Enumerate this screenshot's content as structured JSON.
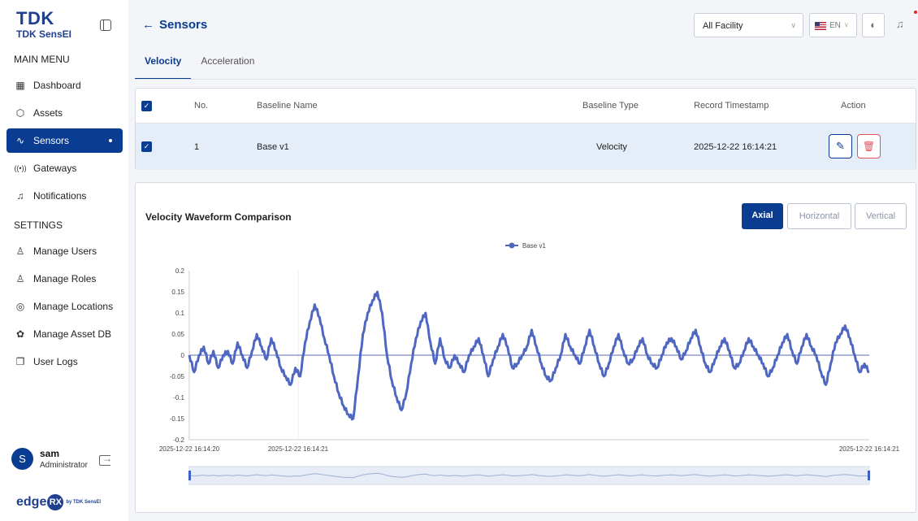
{
  "brand": {
    "logo_text": "TDK",
    "product": "TDK SensEI",
    "footer_logo": "edge",
    "footer_rx": "RX",
    "footer_by": "by TDK SensEI"
  },
  "sidebar": {
    "main_menu_title": "MAIN MENU",
    "settings_title": "SETTINGS",
    "main_items": [
      {
        "label": "Dashboard",
        "icon": "dashboard-icon"
      },
      {
        "label": "Assets",
        "icon": "cube-icon"
      },
      {
        "label": "Sensors",
        "icon": "pulse-icon",
        "active": true
      },
      {
        "label": "Gateways",
        "icon": "broadcast-icon"
      },
      {
        "label": "Notifications",
        "icon": "bell-icon"
      }
    ],
    "settings_items": [
      {
        "label": "Manage Users",
        "icon": "user-icon"
      },
      {
        "label": "Manage Roles",
        "icon": "role-icon"
      },
      {
        "label": "Manage Locations",
        "icon": "location-icon"
      },
      {
        "label": "Manage Asset DB",
        "icon": "database-icon"
      },
      {
        "label": "User Logs",
        "icon": "logs-icon"
      }
    ]
  },
  "user": {
    "initial": "S",
    "name": "sam",
    "role": "Administrator"
  },
  "header": {
    "title": "Sensors",
    "facility_select": "All Facility",
    "language": "EN",
    "tabs": [
      {
        "label": "Velocity",
        "active": true
      },
      {
        "label": "Acceleration",
        "active": false
      }
    ]
  },
  "table": {
    "columns": [
      "No.",
      "Baseline Name",
      "Baseline Type",
      "Record Timestamp",
      "Action"
    ],
    "rows": [
      {
        "no": "1",
        "name": "Base v1",
        "type": "Velocity",
        "timestamp": "2025-12-22 16:14:21",
        "selected": true
      }
    ]
  },
  "chart_card": {
    "title": "Velocity Waveform Comparison",
    "axis_buttons": [
      {
        "label": "Axial",
        "active": true
      },
      {
        "label": "Horizontal",
        "active": false
      },
      {
        "label": "Vertical",
        "active": false
      }
    ]
  },
  "chart_data": {
    "type": "line",
    "title": "Velocity Waveform Comparison",
    "legend_position": "top-center",
    "ylim": [
      -0.2,
      0.2
    ],
    "y_ticks": [
      "0.2",
      "0.15",
      "0.1",
      "0.05",
      "0",
      "-0.05",
      "-0.1",
      "-0.15",
      "-0.2"
    ],
    "x_tick_labels": [
      "2025-12-22 16:14:20",
      "2025-12-22 16:14:21",
      "2025-12-22 16:14:21"
    ],
    "series": [
      {
        "name": "Base v1",
        "color": "#4f67c1",
        "values": [
          0.0,
          -0.04,
          0.0,
          0.02,
          -0.02,
          0.01,
          -0.03,
          0.0,
          0.01,
          -0.02,
          0.03,
          0.0,
          -0.03,
          0.01,
          0.05,
          0.02,
          -0.01,
          0.04,
          0.01,
          -0.03,
          -0.05,
          -0.07,
          -0.03,
          -0.05,
          0.03,
          0.08,
          0.12,
          0.09,
          0.04,
          0.0,
          -0.05,
          -0.09,
          -0.12,
          -0.14,
          -0.15,
          -0.05,
          0.05,
          0.1,
          0.13,
          0.15,
          0.1,
          0.0,
          -0.06,
          -0.1,
          -0.13,
          -0.09,
          -0.02,
          0.04,
          0.08,
          0.1,
          0.03,
          -0.02,
          0.04,
          -0.01,
          -0.03,
          0.0,
          -0.02,
          -0.04,
          0.0,
          0.02,
          0.04,
          0.0,
          -0.05,
          -0.01,
          0.02,
          0.05,
          0.02,
          -0.03,
          -0.02,
          0.0,
          0.02,
          0.06,
          0.02,
          -0.02,
          -0.05,
          -0.06,
          -0.03,
          0.0,
          0.05,
          0.02,
          0.0,
          -0.02,
          0.02,
          0.06,
          0.02,
          -0.02,
          -0.05,
          -0.02,
          0.02,
          0.05,
          0.01,
          -0.02,
          -0.01,
          0.02,
          0.04,
          0.0,
          -0.02,
          -0.03,
          0.0,
          0.03,
          0.04,
          0.02,
          -0.01,
          0.01,
          0.04,
          0.06,
          0.02,
          -0.02,
          -0.04,
          -0.01,
          0.02,
          0.04,
          0.01,
          -0.03,
          -0.02,
          0.01,
          0.04,
          0.02,
          0.0,
          -0.02,
          -0.05,
          -0.03,
          0.0,
          0.03,
          0.05,
          0.01,
          -0.02,
          0.02,
          0.05,
          0.02,
          0.0,
          -0.04,
          -0.07,
          -0.02,
          0.03,
          0.05,
          0.07,
          0.04,
          0.0,
          -0.04,
          -0.02,
          -0.04
        ]
      }
    ]
  }
}
